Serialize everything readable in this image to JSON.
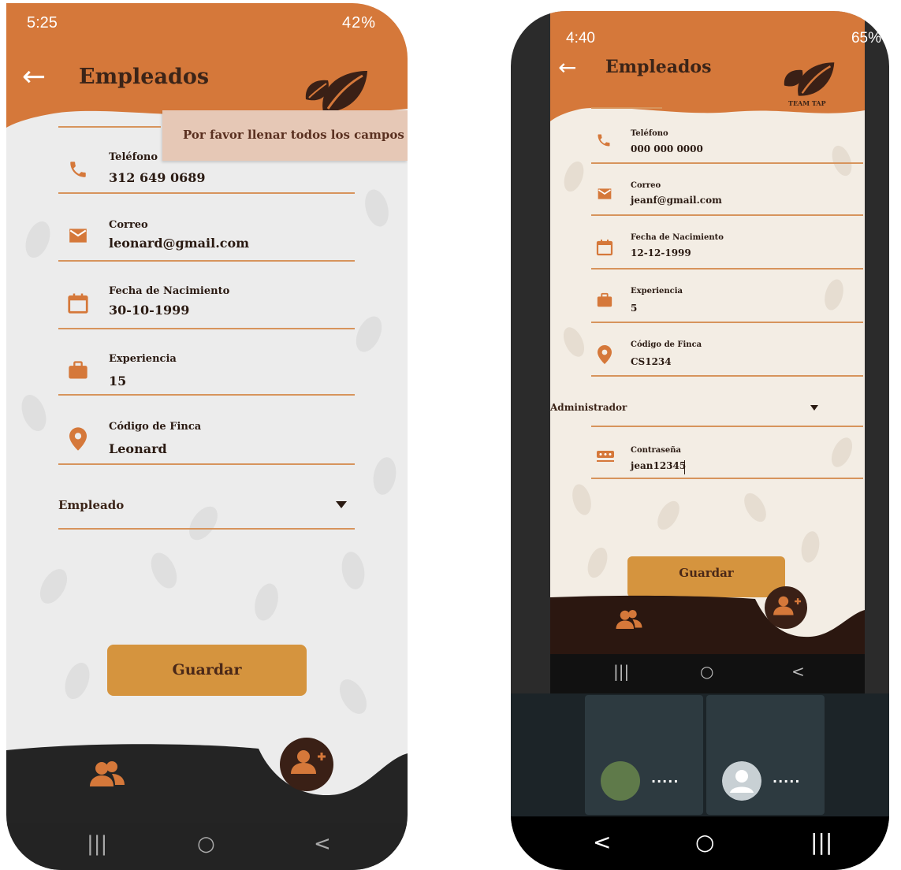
{
  "phone1": {
    "status": {
      "time": "5:25",
      "indicators": "42%"
    },
    "title": "Empleados",
    "toast": "Por favor llenar todos los campos",
    "fields": [
      {
        "label": "Teléfono",
        "value": "312 649 0689",
        "icon": "phone-icon"
      },
      {
        "label": "Correo",
        "value": "leonard@gmail.com",
        "icon": "mail-icon"
      },
      {
        "label": "Fecha de Nacimiento",
        "value": "30-10-1999",
        "icon": "calendar-icon"
      },
      {
        "label": "Experiencia",
        "value": "15",
        "icon": "briefcase-icon"
      },
      {
        "label": "Código de Finca",
        "value": "Leonard",
        "icon": "location-pin-icon"
      }
    ],
    "role": "Empleado",
    "save_label": "Guardar",
    "nav": {
      "recents": "|||",
      "home": "○",
      "back": "<"
    }
  },
  "phone2": {
    "status": {
      "time": "4:40",
      "indicators": "65%"
    },
    "title": "Empleados",
    "logo_text": "TEAM TAP",
    "fields": [
      {
        "label": "Teléfono",
        "value": "000 000 0000",
        "icon": "phone-icon"
      },
      {
        "label": "Correo",
        "value": "jeanf@gmail.com",
        "icon": "mail-icon"
      },
      {
        "label": "Fecha de Nacimiento",
        "value": "12-12-1999",
        "icon": "calendar-icon"
      },
      {
        "label": "Experiencia",
        "value": "5",
        "icon": "briefcase-icon"
      },
      {
        "label": "Código de Finca",
        "value": "CS1234",
        "icon": "location-pin-icon"
      }
    ],
    "role": "Administrador",
    "password": {
      "label": "Contraseña",
      "value": "jean12345"
    },
    "save_label": "Guardar",
    "app_nav": {
      "recents": "|||",
      "home": "○",
      "back": "<"
    },
    "call_tiles": [
      {
        "name": "....."
      },
      {
        "name": "....."
      }
    ],
    "sys_nav": {
      "back": "<",
      "home": "○",
      "recents": "|||"
    }
  },
  "colors": {
    "header": "#d5783a",
    "accent": "#d7945c",
    "button": "#d5943e",
    "dark": "#2a1a12"
  }
}
